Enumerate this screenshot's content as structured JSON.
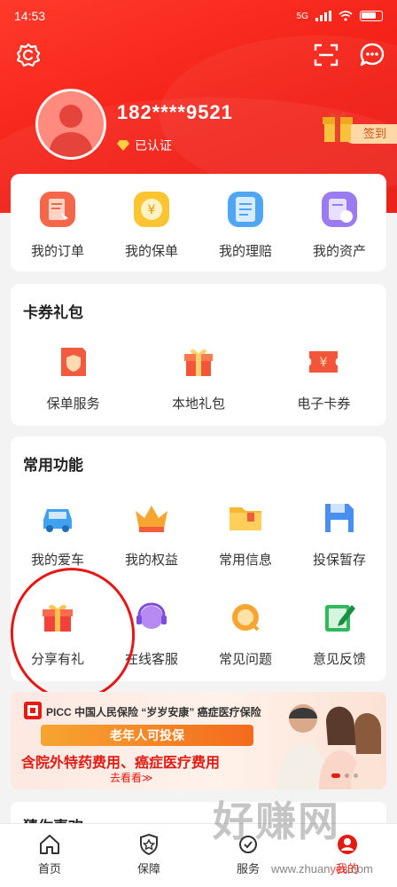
{
  "status_bar": {
    "time": "14:53",
    "network": "5G",
    "battery": ""
  },
  "profile": {
    "phone": "182****9521",
    "verified_label": "已认证",
    "signin_label": "签到"
  },
  "orders": [
    {
      "label": "我的订单",
      "icon": "order-icon"
    },
    {
      "label": "我的保单",
      "icon": "policy-icon"
    },
    {
      "label": "我的理赔",
      "icon": "claim-icon"
    },
    {
      "label": "我的资产",
      "icon": "assets-icon"
    }
  ],
  "coupons": {
    "title": "卡券礼包",
    "items": [
      {
        "label": "保单服务",
        "icon": "policy-service-icon"
      },
      {
        "label": "本地礼包",
        "icon": "gift-box-icon"
      },
      {
        "label": "电子卡券",
        "icon": "coupon-icon"
      }
    ]
  },
  "functions": {
    "title": "常用功能",
    "row1": [
      {
        "label": "我的爱车",
        "icon": "car-icon"
      },
      {
        "label": "我的权益",
        "icon": "crown-icon"
      },
      {
        "label": "常用信息",
        "icon": "folder-icon"
      },
      {
        "label": "投保暂存",
        "icon": "save-icon"
      }
    ],
    "row2": [
      {
        "label": "分享有礼",
        "icon": "gift-icon"
      },
      {
        "label": "在线客服",
        "icon": "headset-icon"
      },
      {
        "label": "常见问题",
        "icon": "faq-icon"
      },
      {
        "label": "意见反馈",
        "icon": "feedback-icon"
      }
    ]
  },
  "banner": {
    "brand": "PICC 中国人民保险 “岁岁安康” 癌症医疗保险",
    "ribbon": "老年人可投保",
    "slogan": "含院外特药费用、癌症医疗费用",
    "cta": "去看看≫"
  },
  "guess_title": "猜你喜欢",
  "tabbar": [
    {
      "label": "首页",
      "icon": "home-icon"
    },
    {
      "label": "保障",
      "icon": "shield-icon"
    },
    {
      "label": "服务",
      "icon": "service-icon"
    },
    {
      "label": "我的",
      "icon": "user-icon"
    }
  ],
  "watermark": {
    "text": "好赚网",
    "url_a": "www.zhuan",
    "url_b": "yes",
    "url_c": ".com"
  },
  "colors": {
    "brand_red": "#e31b12",
    "header_red": "#f21d14"
  }
}
